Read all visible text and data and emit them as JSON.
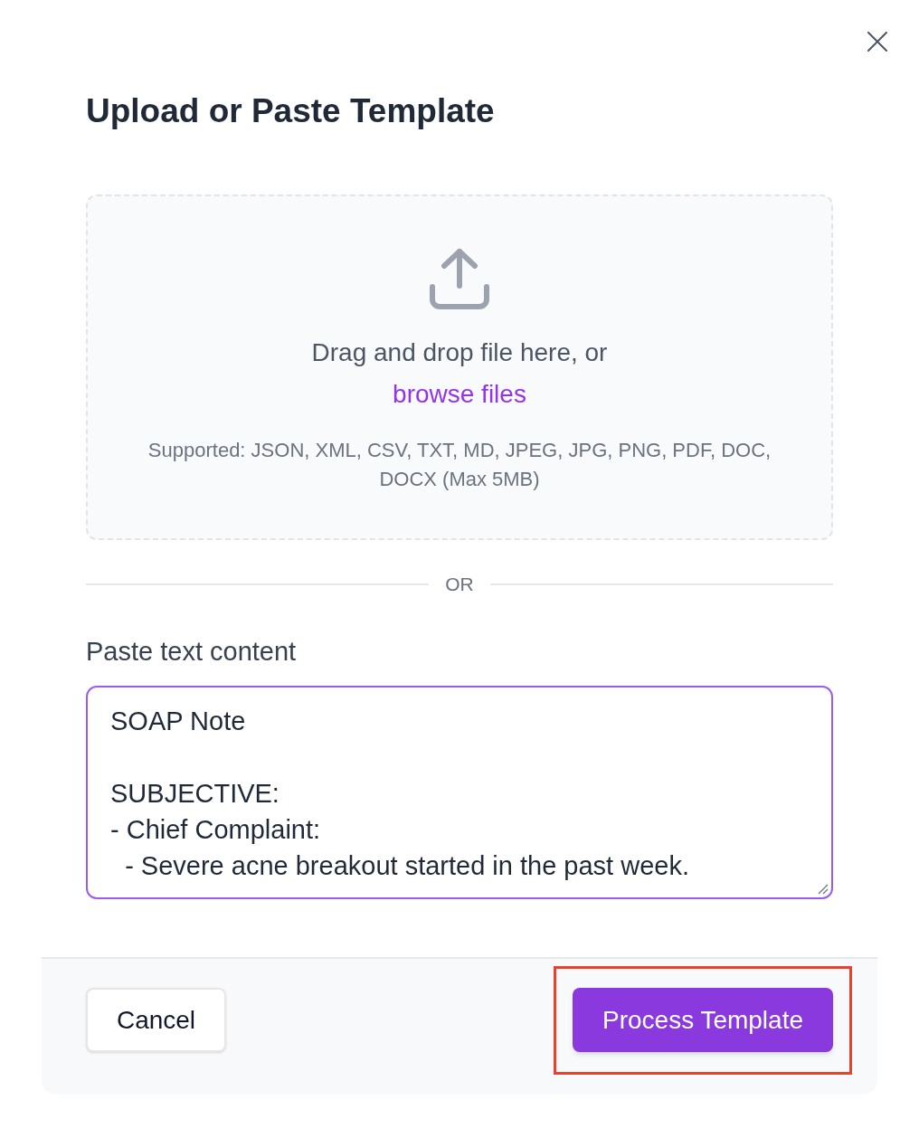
{
  "dialog": {
    "title": "Upload or Paste Template"
  },
  "dropzone": {
    "prompt": "Drag and drop file here, or",
    "browse_link": "browse files",
    "supported_formats": "Supported: JSON, XML, CSV, TXT, MD, JPEG, JPG, PNG, PDF, DOC, DOCX (Max 5MB)"
  },
  "divider": {
    "label": "OR"
  },
  "paste_field": {
    "label": "Paste text content",
    "value": "SOAP Note\n\nSUBJECTIVE:\n- Chief Complaint:\n  - Severe acne breakout started in the past week.",
    "focused": true
  },
  "footer": {
    "buttons": [
      {
        "kind": "secondary",
        "label": "Cancel",
        "highlighted": false
      },
      {
        "kind": "primary",
        "label": "Process Template",
        "highlighted": true
      }
    ]
  }
}
